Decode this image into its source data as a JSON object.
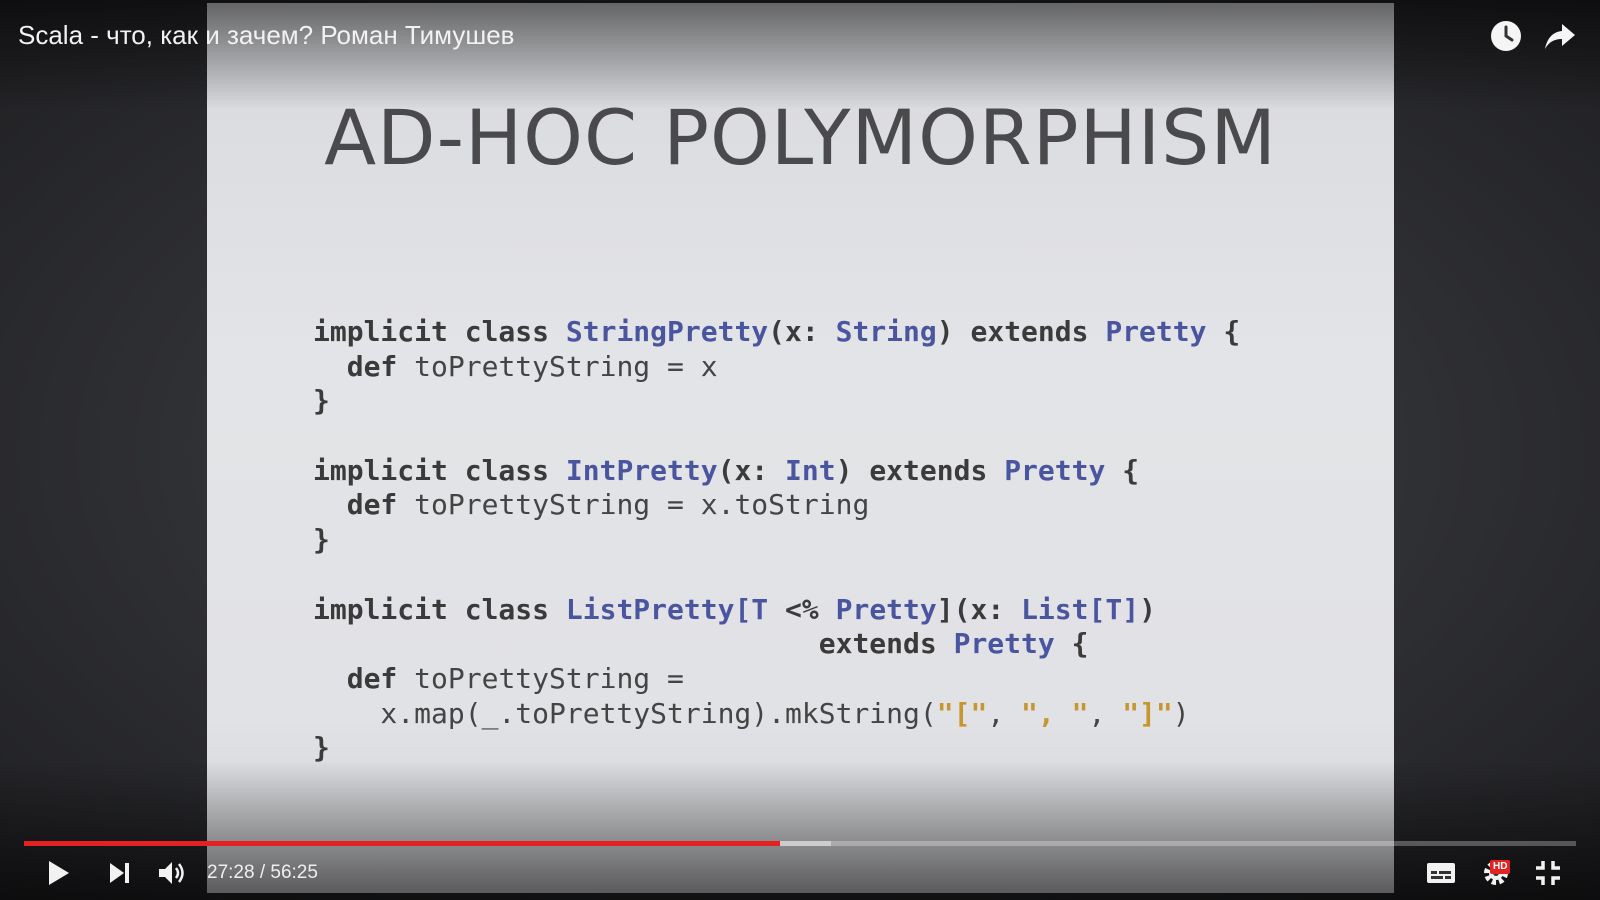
{
  "video": {
    "title": "Scala - что, как и зачем? Роман Тимушев"
  },
  "slide": {
    "title": "AD-HOC POLYMORPHISM",
    "code": {
      "l1": {
        "kw": "implicit class ",
        "ty1": "StringPretty",
        "p1": "(x: ",
        "ty2": "String",
        "p2": ") extends ",
        "ty3": "Pretty",
        "p3": " {"
      },
      "l2": {
        "kw": "  def ",
        "rest": "toPrettyString = x"
      },
      "l3": "}",
      "l4": {
        "kw": "implicit class ",
        "ty1": "IntPretty",
        "p1": "(x: ",
        "ty2": "Int",
        "p2": ") extends ",
        "ty3": "Pretty",
        "p3": " {"
      },
      "l5": {
        "kw": "  def ",
        "rest": "toPrettyString = x.toString"
      },
      "l6": "}",
      "l7": {
        "kw": "implicit class ",
        "ty1": "ListPretty[T",
        "p1": " <% ",
        "ty2": "Pretty",
        "p2": "](x: ",
        "ty3": "List[T]",
        "p3": ")"
      },
      "l8": {
        "pad": "                              extends ",
        "ty": "Pretty",
        "p": " {"
      },
      "l9": {
        "kw": "  def ",
        "rest": "toPrettyString ="
      },
      "l10": {
        "a": "    x.map(_.toPrettyString).mkString(",
        "s1": "\"[\"",
        "c1": ", ",
        "s2": "\", \"",
        "c2": ", ",
        "s3": "\"]\"",
        "b": ")"
      },
      "l11": "}"
    }
  },
  "player": {
    "current_time": "27:28",
    "separator": " / ",
    "duration": "56:25",
    "played_fraction": 0.487,
    "buffered_fraction": 0.52,
    "hd_label": "HD",
    "colors": {
      "accent": "#e52222"
    },
    "icons": {
      "watch_later": "clock-icon",
      "share": "share-arrow-icon",
      "play": "play-icon",
      "next": "skip-next-icon",
      "volume": "volume-icon",
      "subtitles": "subtitles-icon",
      "settings": "gear-icon",
      "exit_fullscreen": "exit-fullscreen-icon"
    }
  }
}
